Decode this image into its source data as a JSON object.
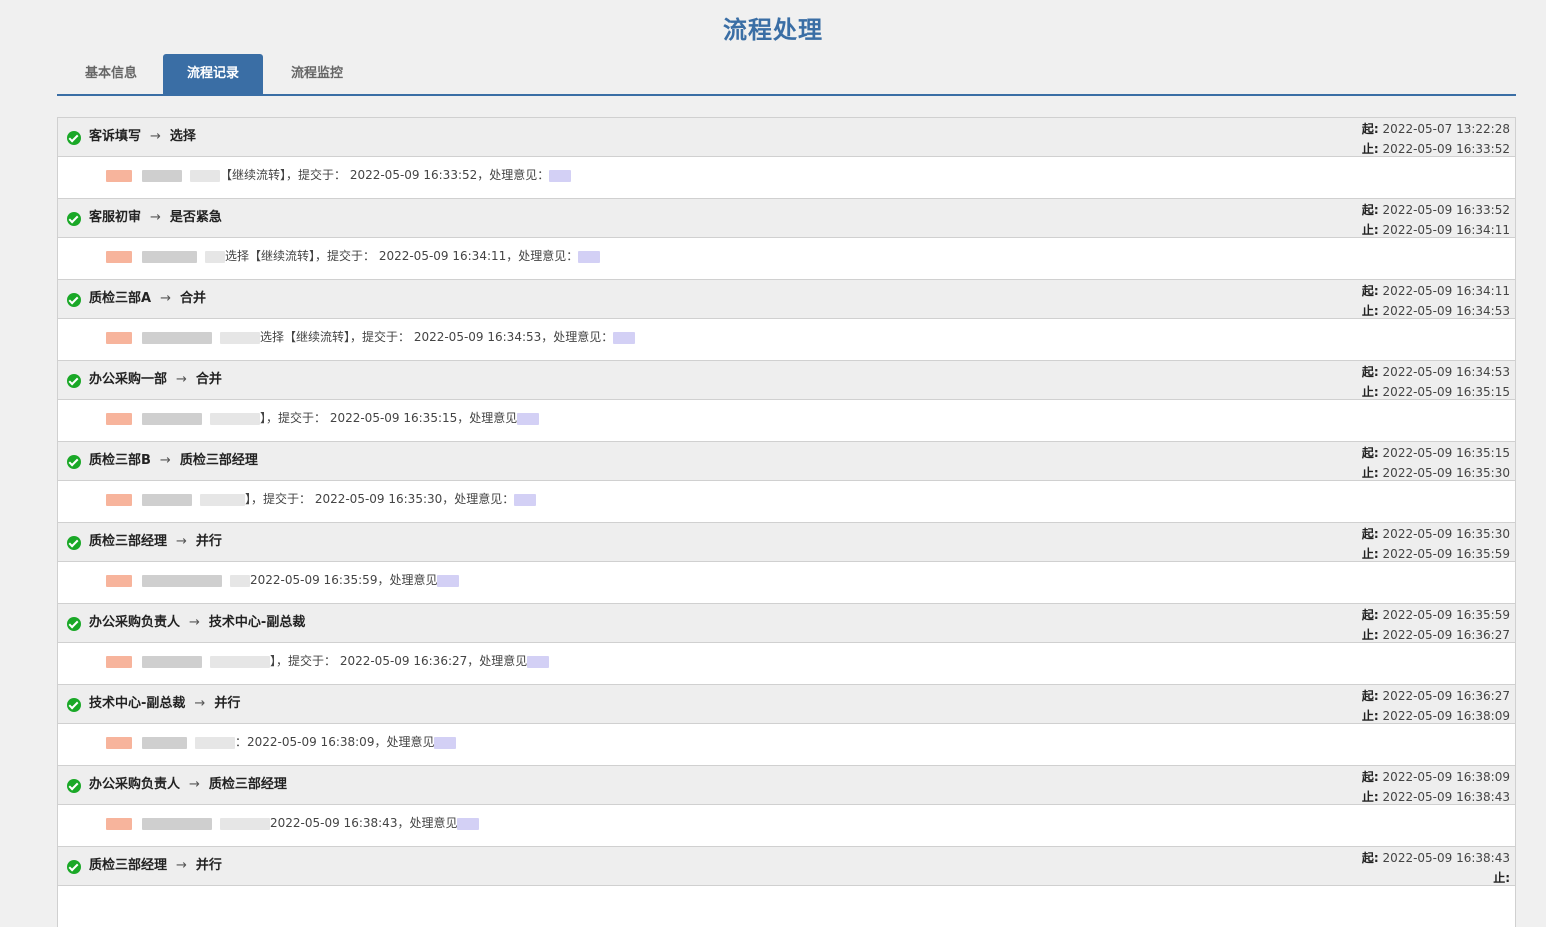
{
  "page": {
    "title": "流程处理"
  },
  "tabs": [
    {
      "label": "基本信息",
      "active": false
    },
    {
      "label": "流程记录",
      "active": true
    },
    {
      "label": "流程监控",
      "active": false
    }
  ],
  "labels": {
    "start": "起:",
    "end": "止:"
  },
  "colors": {
    "accent": "#3a6ea5",
    "success": "#1aa827"
  },
  "records": [
    {
      "from": "客诉填写",
      "to": "选择",
      "start": "2022-05-07 13:22:28",
      "end": "2022-05-09 16:33:52",
      "detail": "【继续流转】，提交于： 2022-05-09 16:33:52，处理意见："
    },
    {
      "from": "客服初审",
      "to": "是否紧急",
      "start": "2022-05-09 16:33:52",
      "end": "2022-05-09 16:34:11",
      "detail": "选择【继续流转】，提交于： 2022-05-09 16:34:11，处理意见："
    },
    {
      "from": "质检三部A",
      "to": "合并",
      "start": "2022-05-09 16:34:11",
      "end": "2022-05-09 16:34:53",
      "detail": "选择【继续流转】，提交于： 2022-05-09 16:34:53，处理意见："
    },
    {
      "from": "办公采购一部",
      "to": "合并",
      "start": "2022-05-09 16:34:53",
      "end": "2022-05-09 16:35:15",
      "detail": "】，提交于： 2022-05-09 16:35:15，处理意见"
    },
    {
      "from": "质检三部B",
      "to": "质检三部经理",
      "start": "2022-05-09 16:35:15",
      "end": "2022-05-09 16:35:30",
      "detail": "】，提交于： 2022-05-09 16:35:30，处理意见："
    },
    {
      "from": "质检三部经理",
      "to": "并行",
      "start": "2022-05-09 16:35:30",
      "end": "2022-05-09 16:35:59",
      "detail": "2022-05-09 16:35:59，处理意见"
    },
    {
      "from": "办公采购负责人",
      "to": "技术中心-副总裁",
      "start": "2022-05-09 16:35:59",
      "end": "2022-05-09 16:36:27",
      "detail": "】，提交于： 2022-05-09 16:36:27，处理意见"
    },
    {
      "from": "技术中心-副总裁",
      "to": "并行",
      "start": "2022-05-09 16:36:27",
      "end": "2022-05-09 16:38:09",
      "detail": "：2022-05-09 16:38:09，处理意见"
    },
    {
      "from": "办公采购负责人",
      "to": "质检三部经理",
      "start": "2022-05-09 16:38:09",
      "end": "2022-05-09 16:38:43",
      "detail": "2022-05-09 16:38:43，处理意见"
    },
    {
      "from": "质检三部经理",
      "to": "并行",
      "start": "2022-05-09 16:38:43",
      "end": "",
      "detail": ""
    }
  ]
}
